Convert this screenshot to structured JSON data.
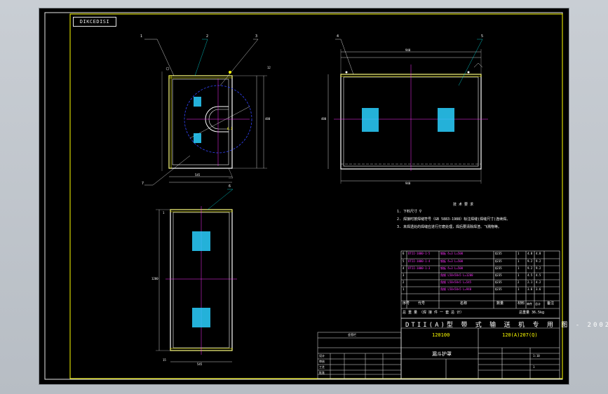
{
  "drawing": {
    "tab_label": "DIKCEDISI",
    "balloons": [
      "1",
      "2",
      "3",
      "4",
      "5",
      "6",
      "7"
    ],
    "dims": {
      "front_width": "545",
      "front_height": "480",
      "side_width": "940",
      "side_top": "940",
      "side_height": "480",
      "bottom_width": "545",
      "bottom_height": "1200",
      "marks": [
        "1",
        "2",
        "3",
        "4",
        "5",
        "6",
        "7",
        "12",
        "15"
      ]
    },
    "roughness_label": "6.3"
  },
  "notes": {
    "heading": "技 术 要 求",
    "items": [
      "1. 下料尺寸 ∇",
      "2. 焊接时按焊缝符号（GB 5883-1988）标注焊缝(焊缝尺寸)连续焊。",
      "3. 未焊透处的焊缝应进行打磨处理，焊后要清除焊渣、飞溅物等。"
    ]
  },
  "bom": {
    "rows": [
      {
        "no": "6",
        "code": "DTII-1000-1-5",
        "name": "钢板 δ=3 L=500",
        "qty": "1",
        "mat": "Q235",
        "wt": "4.8",
        "total": "4.8",
        "note": ""
      },
      {
        "no": "5",
        "code": "DTII-1000-1-4",
        "name": "钢板 δ=3 L=500",
        "qty": "1",
        "mat": "Q235",
        "wt": "9.2",
        "total": "9.2",
        "note": ""
      },
      {
        "no": "4",
        "code": "DTII-1000-1-3",
        "name": "钢板 δ=3 L=500",
        "qty": "1",
        "mat": "Q235",
        "wt": "9.2",
        "total": "9.2",
        "note": ""
      },
      {
        "no": "3",
        "code": "",
        "name": "角钢 L50×50×5 L=1200",
        "qty": "1",
        "mat": "Q235",
        "wt": "4.5",
        "total": "4.5",
        "note": ""
      },
      {
        "no": "2",
        "code": "",
        "name": "角钢 L50×50×5 L=545",
        "qty": "2",
        "mat": "Q235",
        "wt": "2.1",
        "total": "4.2",
        "note": ""
      },
      {
        "no": "1",
        "code": "",
        "name": "角钢 L50×50×5 L=940",
        "qty": "1",
        "mat": "Q235",
        "wt": "3.6",
        "total": "3.6",
        "note": ""
      }
    ],
    "header": [
      "序号",
      "代号",
      "名称",
      "数量",
      "材料",
      "单件",
      "总计",
      "备注"
    ],
    "summary_left": "总 重 量 （焊 接 件 一 套 总 计）",
    "summary_right": "总重量 36.5kg"
  },
  "titleblock": {
    "main_title": "DTII(A)型 带 式 输 送 机 专 用 图 - 2002",
    "part_code": "120100",
    "drawing_no": "120(A)207(Q)",
    "part_name": "漏斗护罩",
    "scale": "1:10",
    "sheet": "1",
    "approval_title": "会签栏",
    "approval_rows": [
      "设计",
      "审核",
      "工艺",
      "批准"
    ]
  }
}
